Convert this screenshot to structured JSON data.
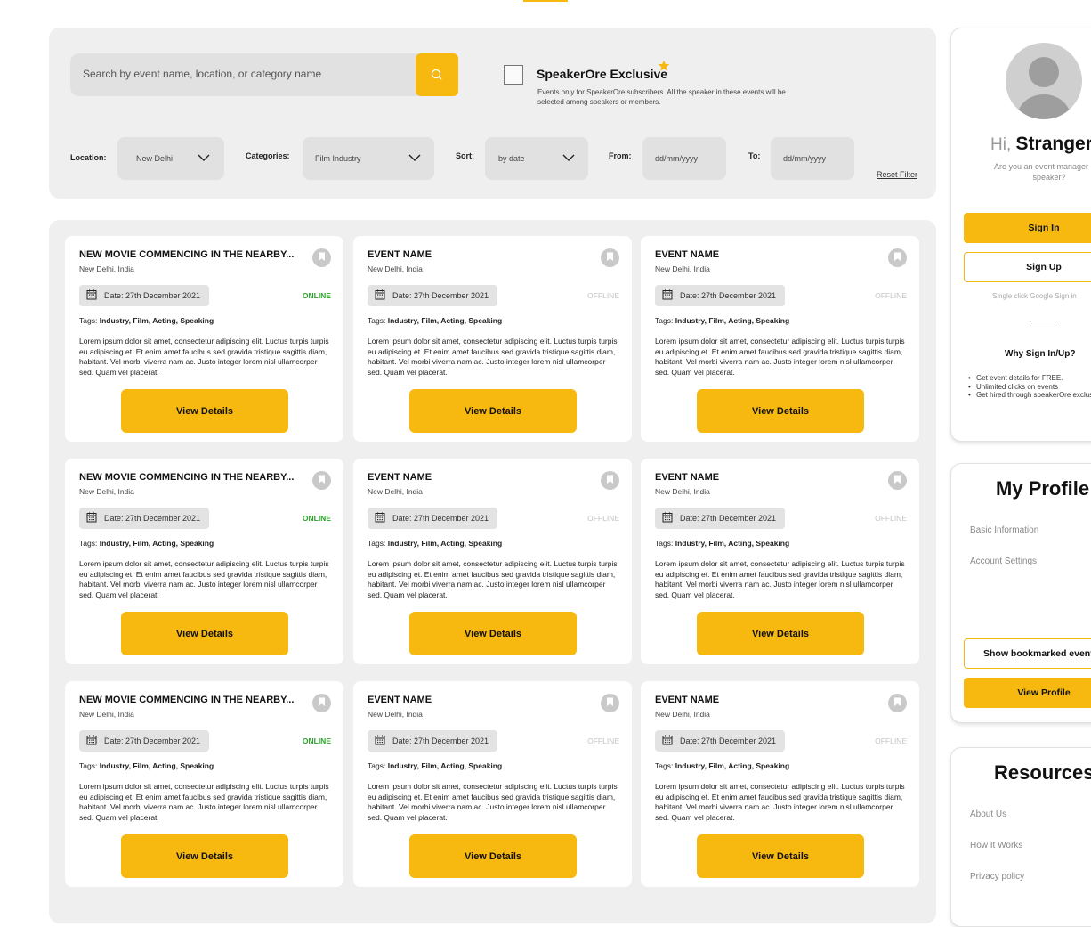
{
  "filters": {
    "search_placeholder": "Search by event name, location, or category name",
    "exclusive_title": "SpeakerOre Exclusive",
    "exclusive_desc": "Events only for SpeakerOre subscribers. All the speaker in these events will be selected among speakers or members.",
    "location_label": "Location:",
    "location_value": "New Delhi",
    "categories_label": "Categories:",
    "categories_value": "Film Industry",
    "sort_label": "Sort:",
    "sort_value": "by date",
    "from_label": "From:",
    "from_placeholder": "dd/mm/yyyy",
    "to_label": "To:",
    "to_placeholder": "dd/mm/yyyy",
    "reset_label": "Reset Filter"
  },
  "events": [
    {
      "title": "NEW MOVIE COMMENCING IN THE NEARBY...",
      "location": "New Delhi, India",
      "date": "Date: 27th December 2021",
      "status": "ONLINE",
      "tags_label": "Tags:",
      "tags": "Industry, Film, Acting, Speaking",
      "description": "Lorem ipsum dolor sit amet, consectetur adipiscing elit. Luctus turpis turpis eu adipiscing et. Et enim amet faucibus sed gravida tristique sagittis diam, habitant. Vel morbi viverra nam ac. Justo integer lorem nisl ullamcorper sed. Quam vel placerat.",
      "button": "View Details"
    },
    {
      "title": "EVENT NAME",
      "location": "New Delhi, India",
      "date": "Date: 27th December 2021",
      "status": "OFFLINE",
      "tags_label": "Tags:",
      "tags": "Industry, Film, Acting, Speaking",
      "description": "Lorem ipsum dolor sit amet, consectetur adipiscing elit. Luctus turpis turpis eu adipiscing et. Et enim amet faucibus sed gravida tristique sagittis diam, habitant. Vel morbi viverra nam ac. Justo integer lorem nisl ullamcorper sed. Quam vel placerat.",
      "button": "View Details"
    },
    {
      "title": "EVENT NAME",
      "location": "New Delhi, India",
      "date": "Date: 27th December 2021",
      "status": "OFFLINE",
      "tags_label": "Tags:",
      "tags": "Industry, Film, Acting, Speaking",
      "description": "Lorem ipsum dolor sit amet, consectetur adipiscing elit. Luctus turpis turpis eu adipiscing et. Et enim amet faucibus sed gravida tristique sagittis diam, habitant. Vel morbi viverra nam ac. Justo integer lorem nisl ullamcorper sed. Quam vel placerat.",
      "button": "View Details"
    },
    {
      "title": "NEW MOVIE COMMENCING IN THE NEARBY...",
      "location": "New Delhi, India",
      "date": "Date: 27th December 2021",
      "status": "ONLINE",
      "tags_label": "Tags:",
      "tags": "Industry, Film, Acting, Speaking",
      "description": "Lorem ipsum dolor sit amet, consectetur adipiscing elit. Luctus turpis turpis eu adipiscing et. Et enim amet faucibus sed gravida tristique sagittis diam, habitant. Vel morbi viverra nam ac. Justo integer lorem nisl ullamcorper sed. Quam vel placerat.",
      "button": "View Details"
    },
    {
      "title": "EVENT NAME",
      "location": "New Delhi, India",
      "date": "Date: 27th December 2021",
      "status": "OFFLINE",
      "tags_label": "Tags:",
      "tags": "Industry, Film, Acting, Speaking",
      "description": "Lorem ipsum dolor sit amet, consectetur adipiscing elit. Luctus turpis turpis eu adipiscing et. Et enim amet faucibus sed gravida tristique sagittis diam, habitant. Vel morbi viverra nam ac. Justo integer lorem nisl ullamcorper sed. Quam vel placerat.",
      "button": "View Details"
    },
    {
      "title": "EVENT NAME",
      "location": "New Delhi, India",
      "date": "Date: 27th December 2021",
      "status": "OFFLINE",
      "tags_label": "Tags:",
      "tags": "Industry, Film, Acting, Speaking",
      "description": "Lorem ipsum dolor sit amet, consectetur adipiscing elit. Luctus turpis turpis eu adipiscing et. Et enim amet faucibus sed gravida tristique sagittis diam, habitant. Vel morbi viverra nam ac. Justo integer lorem nisl ullamcorper sed. Quam vel placerat.",
      "button": "View Details"
    },
    {
      "title": "NEW MOVIE COMMENCING IN THE NEARBY...",
      "location": "New Delhi, India",
      "date": "Date: 27th December 2021",
      "status": "ONLINE",
      "tags_label": "Tags:",
      "tags": "Industry, Film, Acting, Speaking",
      "description": "Lorem ipsum dolor sit amet, consectetur adipiscing elit. Luctus turpis turpis eu adipiscing et. Et enim amet faucibus sed gravida tristique sagittis diam, habitant. Vel morbi viverra nam ac. Justo integer lorem nisl ullamcorper sed. Quam vel placerat.",
      "button": "View Details"
    },
    {
      "title": "EVENT NAME",
      "location": "New Delhi, India",
      "date": "Date: 27th December 2021",
      "status": "OFFLINE",
      "tags_label": "Tags:",
      "tags": "Industry, Film, Acting, Speaking",
      "description": "Lorem ipsum dolor sit amet, consectetur adipiscing elit. Luctus turpis turpis eu adipiscing et. Et enim amet faucibus sed gravida tristique sagittis diam, habitant. Vel morbi viverra nam ac. Justo integer lorem nisl ullamcorper sed. Quam vel placerat.",
      "button": "View Details"
    },
    {
      "title": "EVENT NAME",
      "location": "New Delhi, India",
      "date": "Date: 27th December 2021",
      "status": "OFFLINE",
      "tags_label": "Tags:",
      "tags": "Industry, Film, Acting, Speaking",
      "description": "Lorem ipsum dolor sit amet, consectetur adipiscing elit. Luctus turpis turpis eu adipiscing et. Et enim amet faucibus sed gravida tristique sagittis diam, habitant. Vel morbi viverra nam ac. Justo integer lorem nisl ullamcorper sed. Quam vel placerat.",
      "button": "View Details"
    }
  ],
  "sidebar": {
    "greeting_prefix": "Hi,",
    "greeting_name": "Stranger",
    "question": "Are you an event manager or a speaker?",
    "sign_in": "Sign In",
    "sign_up": "Sign Up",
    "google": "Single click Google Sign in",
    "why_title": "Why Sign In/Up?",
    "why_items": [
      "Get event details for FREE.",
      "Unlimited clicks on events",
      "Get hired through speakerOre exclusive events"
    ],
    "profile_title": "My Profile",
    "profile_links": [
      "Basic Information",
      "Account Settings"
    ],
    "bookmarked_button": "Show bookmarked events",
    "view_profile": "View Profile",
    "resources_title": "Resources",
    "resource_links": [
      "About Us",
      "How It Works",
      "Privacy policy"
    ]
  },
  "colors": {
    "accent": "#f7b90f",
    "online": "#2aa12a",
    "offline": "#c4c4c4",
    "panel": "#efefef"
  },
  "icons": {
    "search": "search-icon",
    "star": "star-icon",
    "bookmark": "bookmark-icon",
    "calendar": "calendar-icon",
    "chevron": "chevron-down-icon",
    "avatar": "user-avatar"
  }
}
